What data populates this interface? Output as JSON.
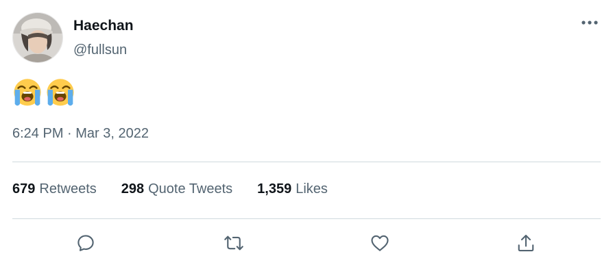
{
  "tweet": {
    "author": {
      "name": "Haechan",
      "handle": "@fullsun"
    },
    "content": {
      "emojis": [
        "loudly-crying-face",
        "loudly-crying-face"
      ]
    },
    "timestamp": "6:24 PM · Mar 3, 2022",
    "stats": {
      "retweets": {
        "count": "679",
        "label": "Retweets"
      },
      "quote_tweets": {
        "count": "298",
        "label": "Quote Tweets"
      },
      "likes": {
        "count": "1,359",
        "label": "Likes"
      }
    },
    "actions": {
      "reply_icon": "reply-icon",
      "retweet_icon": "retweet-icon",
      "like_icon": "heart-icon",
      "share_icon": "share-icon"
    },
    "colors": {
      "text_primary": "#0f1419",
      "text_secondary": "#536471",
      "divider": "#cfd9de"
    }
  }
}
